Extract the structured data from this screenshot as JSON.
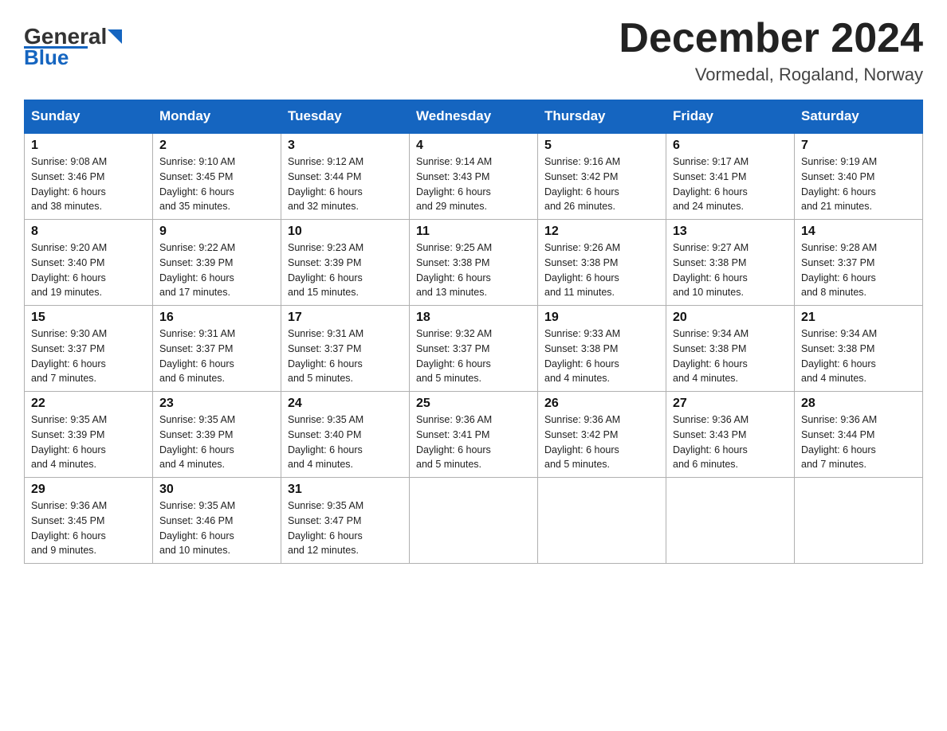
{
  "header": {
    "logo_general": "General",
    "logo_blue": "Blue",
    "month_title": "December 2024",
    "location": "Vormedal, Rogaland, Norway"
  },
  "days_of_week": [
    "Sunday",
    "Monday",
    "Tuesday",
    "Wednesday",
    "Thursday",
    "Friday",
    "Saturday"
  ],
  "weeks": [
    [
      {
        "day": "1",
        "sunrise": "9:08 AM",
        "sunset": "3:46 PM",
        "daylight": "6 hours and 38 minutes."
      },
      {
        "day": "2",
        "sunrise": "9:10 AM",
        "sunset": "3:45 PM",
        "daylight": "6 hours and 35 minutes."
      },
      {
        "day": "3",
        "sunrise": "9:12 AM",
        "sunset": "3:44 PM",
        "daylight": "6 hours and 32 minutes."
      },
      {
        "day": "4",
        "sunrise": "9:14 AM",
        "sunset": "3:43 PM",
        "daylight": "6 hours and 29 minutes."
      },
      {
        "day": "5",
        "sunrise": "9:16 AM",
        "sunset": "3:42 PM",
        "daylight": "6 hours and 26 minutes."
      },
      {
        "day": "6",
        "sunrise": "9:17 AM",
        "sunset": "3:41 PM",
        "daylight": "6 hours and 24 minutes."
      },
      {
        "day": "7",
        "sunrise": "9:19 AM",
        "sunset": "3:40 PM",
        "daylight": "6 hours and 21 minutes."
      }
    ],
    [
      {
        "day": "8",
        "sunrise": "9:20 AM",
        "sunset": "3:40 PM",
        "daylight": "6 hours and 19 minutes."
      },
      {
        "day": "9",
        "sunrise": "9:22 AM",
        "sunset": "3:39 PM",
        "daylight": "6 hours and 17 minutes."
      },
      {
        "day": "10",
        "sunrise": "9:23 AM",
        "sunset": "3:39 PM",
        "daylight": "6 hours and 15 minutes."
      },
      {
        "day": "11",
        "sunrise": "9:25 AM",
        "sunset": "3:38 PM",
        "daylight": "6 hours and 13 minutes."
      },
      {
        "day": "12",
        "sunrise": "9:26 AM",
        "sunset": "3:38 PM",
        "daylight": "6 hours and 11 minutes."
      },
      {
        "day": "13",
        "sunrise": "9:27 AM",
        "sunset": "3:38 PM",
        "daylight": "6 hours and 10 minutes."
      },
      {
        "day": "14",
        "sunrise": "9:28 AM",
        "sunset": "3:37 PM",
        "daylight": "6 hours and 8 minutes."
      }
    ],
    [
      {
        "day": "15",
        "sunrise": "9:30 AM",
        "sunset": "3:37 PM",
        "daylight": "6 hours and 7 minutes."
      },
      {
        "day": "16",
        "sunrise": "9:31 AM",
        "sunset": "3:37 PM",
        "daylight": "6 hours and 6 minutes."
      },
      {
        "day": "17",
        "sunrise": "9:31 AM",
        "sunset": "3:37 PM",
        "daylight": "6 hours and 5 minutes."
      },
      {
        "day": "18",
        "sunrise": "9:32 AM",
        "sunset": "3:37 PM",
        "daylight": "6 hours and 5 minutes."
      },
      {
        "day": "19",
        "sunrise": "9:33 AM",
        "sunset": "3:38 PM",
        "daylight": "6 hours and 4 minutes."
      },
      {
        "day": "20",
        "sunrise": "9:34 AM",
        "sunset": "3:38 PM",
        "daylight": "6 hours and 4 minutes."
      },
      {
        "day": "21",
        "sunrise": "9:34 AM",
        "sunset": "3:38 PM",
        "daylight": "6 hours and 4 minutes."
      }
    ],
    [
      {
        "day": "22",
        "sunrise": "9:35 AM",
        "sunset": "3:39 PM",
        "daylight": "6 hours and 4 minutes."
      },
      {
        "day": "23",
        "sunrise": "9:35 AM",
        "sunset": "3:39 PM",
        "daylight": "6 hours and 4 minutes."
      },
      {
        "day": "24",
        "sunrise": "9:35 AM",
        "sunset": "3:40 PM",
        "daylight": "6 hours and 4 minutes."
      },
      {
        "day": "25",
        "sunrise": "9:36 AM",
        "sunset": "3:41 PM",
        "daylight": "6 hours and 5 minutes."
      },
      {
        "day": "26",
        "sunrise": "9:36 AM",
        "sunset": "3:42 PM",
        "daylight": "6 hours and 5 minutes."
      },
      {
        "day": "27",
        "sunrise": "9:36 AM",
        "sunset": "3:43 PM",
        "daylight": "6 hours and 6 minutes."
      },
      {
        "day": "28",
        "sunrise": "9:36 AM",
        "sunset": "3:44 PM",
        "daylight": "6 hours and 7 minutes."
      }
    ],
    [
      {
        "day": "29",
        "sunrise": "9:36 AM",
        "sunset": "3:45 PM",
        "daylight": "6 hours and 9 minutes."
      },
      {
        "day": "30",
        "sunrise": "9:35 AM",
        "sunset": "3:46 PM",
        "daylight": "6 hours and 10 minutes."
      },
      {
        "day": "31",
        "sunrise": "9:35 AM",
        "sunset": "3:47 PM",
        "daylight": "6 hours and 12 minutes."
      },
      null,
      null,
      null,
      null
    ]
  ],
  "labels": {
    "sunrise": "Sunrise:",
    "sunset": "Sunset:",
    "daylight": "Daylight:"
  },
  "colors": {
    "header_bg": "#1565C0",
    "header_text": "#ffffff",
    "border": "#b0b0b0"
  }
}
